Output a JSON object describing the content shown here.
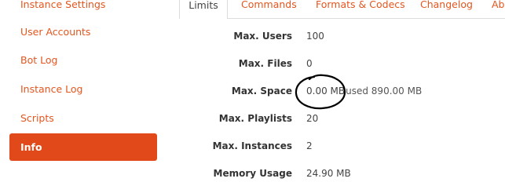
{
  "sidebar": {
    "items": [
      {
        "label": "Instance Settings",
        "active": false
      },
      {
        "label": "User Accounts",
        "active": false
      },
      {
        "label": "Bot Log",
        "active": false
      },
      {
        "label": "Instance Log",
        "active": false
      },
      {
        "label": "Scripts",
        "active": false
      },
      {
        "label": "Info",
        "active": true
      }
    ]
  },
  "tabs": [
    {
      "label": "Limits",
      "active": true
    },
    {
      "label": "Commands",
      "active": false
    },
    {
      "label": "Formats & Codecs",
      "active": false
    },
    {
      "label": "Changelog",
      "active": false
    },
    {
      "label": "Ab",
      "active": false
    }
  ],
  "info": {
    "max_users": {
      "label": "Max. Users",
      "value": "100"
    },
    "max_files": {
      "label": "Max. Files",
      "value": "0"
    },
    "max_space": {
      "label": "Max. Space",
      "value": "0.00 MB",
      "used": "used 890.00 MB"
    },
    "max_playlists": {
      "label": "Max. Playlists",
      "value": "20"
    },
    "max_instances": {
      "label": "Max. Instances",
      "value": "2"
    },
    "memory_usage": {
      "label": "Memory Usage",
      "value": "24.90 MB"
    }
  },
  "colors": {
    "accent": "#e2491a",
    "link": "#e2561f",
    "annotation": "#000000"
  }
}
